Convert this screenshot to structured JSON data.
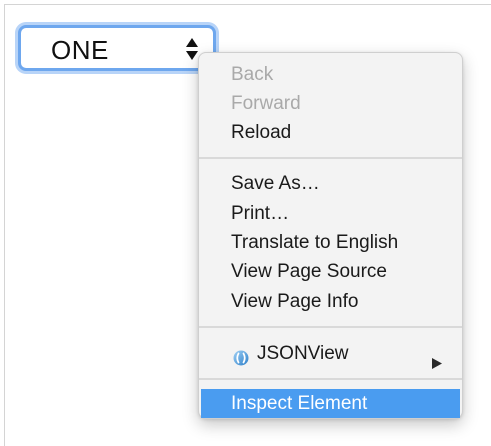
{
  "select": {
    "value": "ONE"
  },
  "context_menu": {
    "group_nav": [
      {
        "label": "Back",
        "enabled": false
      },
      {
        "label": "Forward",
        "enabled": false
      },
      {
        "label": "Reload",
        "enabled": true
      }
    ],
    "group_page": [
      {
        "label": "Save As…"
      },
      {
        "label": "Print…"
      },
      {
        "label": "Translate to English"
      },
      {
        "label": "View Page Source"
      },
      {
        "label": "View Page Info"
      }
    ],
    "extension": {
      "label": "JSONView",
      "icon": "jsonview-extension-icon",
      "submenu_icon": "triangle-right-icon"
    },
    "inspect": {
      "label": "Inspect Element",
      "highlighted": true
    }
  },
  "colors": {
    "focus_ring": "#6ea7ee",
    "highlight": "#4a9cf0",
    "disabled_text": "#a9a9a9",
    "menu_background": "#f3f3f3"
  }
}
